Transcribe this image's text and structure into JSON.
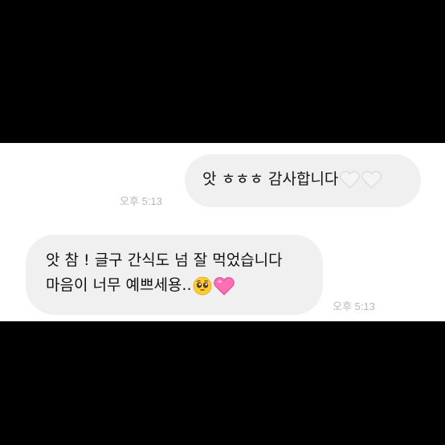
{
  "messages": {
    "sent": {
      "text": "앗 ㅎㅎㅎ 감사합니다",
      "emojis": [
        "white-heart-icon",
        "white-heart-icon"
      ],
      "time": "오후 5:13"
    },
    "received": {
      "line1": "앗 참 ! 글구 간식도 넘 잘 먹었습니다",
      "line2": "마음이 너무 예쁘세용..",
      "emojis": [
        "pleading-face-icon",
        "pink-heart-icon"
      ],
      "time": "오후 5:13"
    }
  },
  "colors": {
    "background": "#000000",
    "chat_background": "#ffffff",
    "bubble": "#f0f0f0",
    "text": "#111111",
    "timestamp": "#b8b8b8",
    "pink_heart": "#ff6fb5",
    "white_heart": "#f4f4f4"
  }
}
